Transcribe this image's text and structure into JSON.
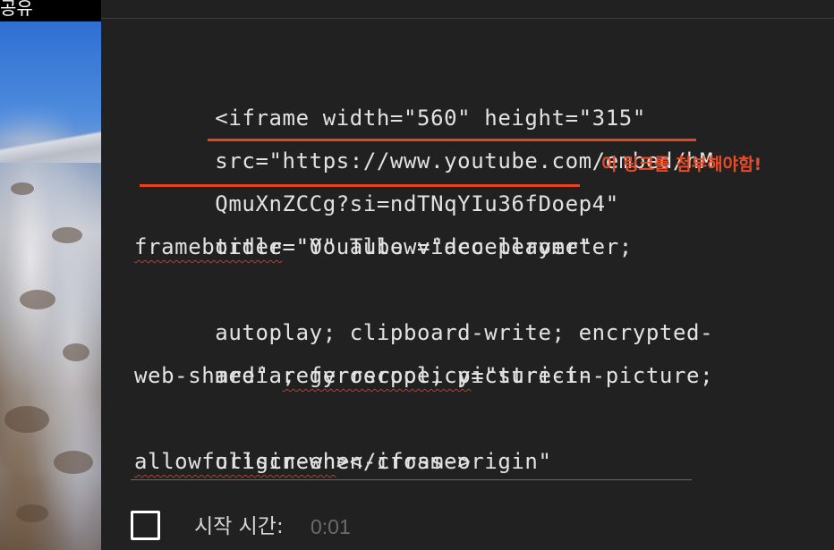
{
  "left_panel": {
    "share_label": "공유"
  },
  "embed_code": {
    "lines": [
      [
        "<iframe width=\"560\" height=\"315\""
      ],
      [
        "src=\"https://www.youtube.com/embed/hM"
      ],
      [
        "QmuXnZCCg?si=ndTNqYIu36fDoep4\""
      ],
      [
        "title=\"YouTube video player\""
      ],
      [
        "frameborder",
        "=\"0\" allow=\"accelerometer;"
      ],
      [
        "autoplay; clipboard-write; encrypted-"
      ],
      [
        "media; gyroscope; picture-in-picture;"
      ],
      [
        "web-share\" ",
        "referrerpolicy",
        "=\"strict-"
      ],
      [
        "origin-when-cross-origin\""
      ],
      [
        "allowfullscreen",
        "></iframe>"
      ]
    ]
  },
  "annotation": {
    "note": "이 링크를 첨부해야함!",
    "color": "#e8421f"
  },
  "start_time": {
    "label": "시작 시간:",
    "value": "0:01",
    "checked": false
  },
  "colors": {
    "background": "#212121",
    "code_text": "#e2e2e2",
    "muted_text": "#6b6b6b",
    "spell_underline": "#c0392b"
  }
}
